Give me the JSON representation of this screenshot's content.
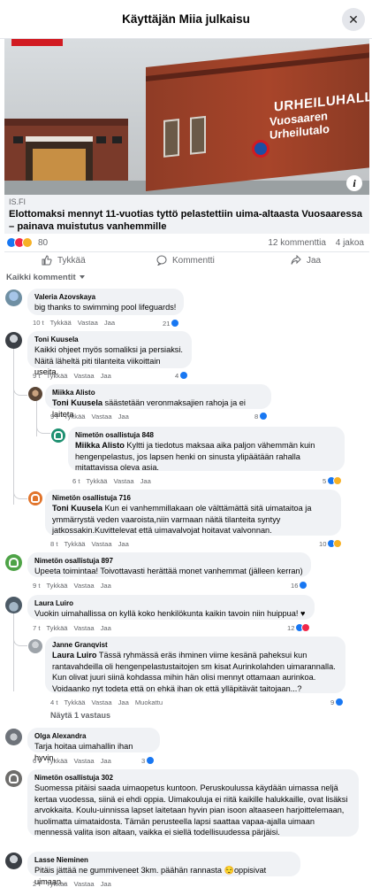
{
  "header": {
    "title": "Käyttäjän Miia julkaisu",
    "close_label": "✕"
  },
  "post": {
    "source": "IS.FI",
    "headline": "Elottomaksi mennyt 11-vuotias tyttö pelastettiin uima-altaasta Vuosaaressa – painava muistutus vanhemmille",
    "image_sign_line1": "URHEILUHALLIT",
    "image_sign_line2": "Vuosaaren Urheilutalo",
    "info_icon": "i",
    "reaction_count": "80",
    "comment_count": "12 kommenttia",
    "share_count": "4 jakoa"
  },
  "actions": {
    "like": "Tykkää",
    "comment": "Kommentti",
    "share": "Jaa"
  },
  "filter_label": "Kaikki kommentit",
  "colors": {
    "like": "#1877f2",
    "love": "#f02849",
    "haha": "#f7b125",
    "meta": "#65676b",
    "bubble": "#f0f2f5"
  },
  "comments": [
    {
      "name": "Valeria Azovskaya",
      "text": "big thanks to swimming pool lifeguards!",
      "time": "10 t",
      "like": "Tykkää",
      "reply": "Vastaa",
      "share": "Jaa",
      "reactions": "21"
    },
    {
      "name": "Toni Kuusela",
      "text": "Kaikki ohjeet myös somaliksi ja persiaksi. Näitä läheltä piti tilanteita viikoittain useita.",
      "time": "9 t",
      "like": "Tykkää",
      "reply": "Vastaa",
      "share": "Jaa",
      "reactions": "4"
    },
    {
      "name": "Miikka Alisto",
      "mention": "Toni Kuusela",
      "text": " säästetään veronmaksajien rahoja ja ei laiteta",
      "time": "9 t",
      "like": "Tykkää",
      "reply": "Vastaa",
      "share": "Jaa",
      "reactions": "8"
    },
    {
      "name": "Nimetön osallistuja 848",
      "mention": "Miikka Alisto",
      "text": " Kyltti ja tiedotus maksaa aika paljon vähemmän kuin hengenpelastus, jos lapsen henki on sinusta ylipäätään rahalla mitattavissa oleva asia.",
      "time": "6 t",
      "like": "Tykkää",
      "reply": "Vastaa",
      "share": "Jaa",
      "reactions": "5"
    },
    {
      "name": "Nimetön osallistuja 716",
      "mention": "Toni Kuusela",
      "text": " Kun ei vanhemmillakaan ole välttämättä sitä uimataitoa ja ymmärrystä veden vaaroista,niin varmaan näitä tilanteita syntyy jatkossakin.Kuvittelevat että uimavalvojat hoitavat valvonnan.",
      "time": "8 t",
      "like": "Tykkää",
      "reply": "Vastaa",
      "share": "Jaa",
      "reactions": "10"
    },
    {
      "name": "Nimetön osallistuja 897",
      "text": "Upeeta toimintaa! Toivottavasti herättää monet vanhemmat (jälleen kerran)",
      "time": "9 t",
      "like": "Tykkää",
      "reply": "Vastaa",
      "share": "Jaa",
      "reactions": "16"
    },
    {
      "name": "Laura Luiro",
      "text": "Vuokin uimahallissa on kyllä koko henkilökunta kaikin tavoin niin huippua! ♥",
      "time": "7 t",
      "like": "Tykkää",
      "reply": "Vastaa",
      "share": "Jaa",
      "reactions": "12"
    },
    {
      "name": "Janne Granqvist",
      "mention": "Laura Luiro",
      "text": " Tässä ryhmässä eräs ihminen viime kesänä paheksui kun rantavahdeilla oli hengenpelastustaitojen sm kisat Aurinkolahden uimarannalla. Kun olivat juuri siinä kohdassa mihin hän olisi mennyt ottamaan aurinkoa. Voidaanko nyt todeta että on ehkä ihan ok että ylläpitävät taitojaan...?",
      "time": "4 t",
      "like": "Tykkää",
      "reply": "Vastaa",
      "share": "Jaa",
      "edited": "Muokattu",
      "reactions": "9"
    },
    {
      "name": "Olga Alexandra",
      "text": "Tarja hoitaa uimahallin ihan hyvin.",
      "time": "6 t",
      "like": "Tykkää",
      "reply": "Vastaa",
      "share": "Jaa",
      "reactions": "3"
    },
    {
      "name": "Nimetön osallistuja 302",
      "text": "Suomessa pitäisi saada uimaopetus kuntoon. Peruskoulussa käydään uimassa neljä kertaa vuodessa, siinä ei ehdi oppia. Uimakouluja ei riitä kaikille halukkaille, ovat lisäksi arvokkaita. Koulu-uinnissa lapset laitetaan hyvin pian isoon altaaseen harjoittelemaan, huolimatta uimataidosta. Tämän perusteella lapsi saattaa vapaa-ajalla uimaan mennessä valita ison altaan, vaikka ei siellä todellisuudessa pärjäisi.",
      "time": ""
    },
    {
      "name": "Lasse Nieminen",
      "text": "Pitäis jättää ne gummiveneet 3km. päähän rannasta 😌oppisivat uimaan .",
      "time": "2 t",
      "like": "Tykkää",
      "reply": "Vastaa",
      "share": "Jaa"
    }
  ],
  "see_replies": "Näytä 1 vastaus"
}
